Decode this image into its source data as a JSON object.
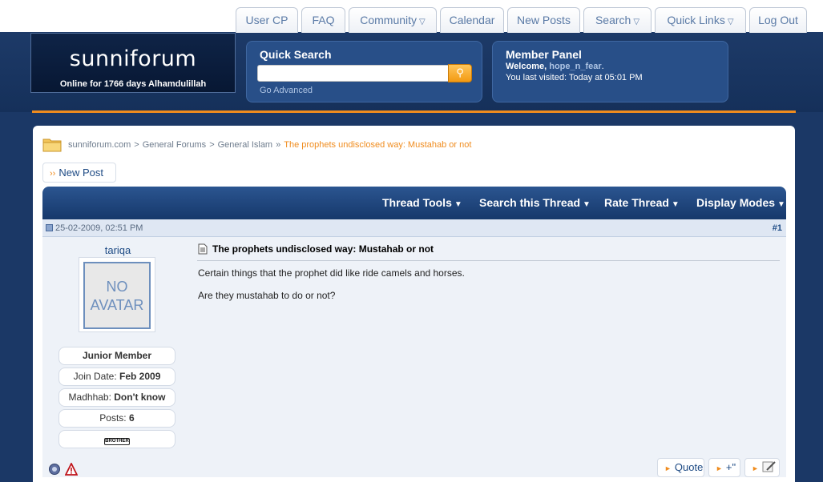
{
  "site": {
    "logo_text": "sunniforum",
    "logo_sub": "Online for 1766 days Alhamdulillah"
  },
  "nav": {
    "tabs": [
      {
        "label": "User CP",
        "has_menu": false
      },
      {
        "label": "FAQ",
        "has_menu": false
      },
      {
        "label": "Community",
        "has_menu": true
      },
      {
        "label": "Calendar",
        "has_menu": false
      },
      {
        "label": "New Posts",
        "has_menu": false
      },
      {
        "label": "Search",
        "has_menu": true
      },
      {
        "label": "Quick Links",
        "has_menu": true
      },
      {
        "label": "Log Out",
        "has_menu": false
      }
    ]
  },
  "quick_search": {
    "title": "Quick Search",
    "value": "",
    "placeholder": "",
    "go_advanced": "Go Advanced",
    "button_icon": "search-icon"
  },
  "member_panel": {
    "title": "Member Panel",
    "welcome_label": "Welcome,",
    "username": "hope_n_fear",
    "username_suffix": ".",
    "last_visit": "You last visited: Today at 05:01 PM"
  },
  "breadcrumb": {
    "items": [
      "sunniforum.com",
      "General Forums",
      "General Islam"
    ],
    "current": "The prophets undisclosed way: Mustahab or not"
  },
  "new_post_label": "New Post",
  "thread_tools": [
    "Thread Tools",
    "Search this Thread",
    "Rate Thread",
    "Display Modes"
  ],
  "post": {
    "date": "25-02-2009, 02:51 PM",
    "number": "#1",
    "author": {
      "name": "tariqa",
      "avatar_text": "NO AVATAR",
      "rank": "Junior Member",
      "join_label": "Join Date:",
      "join_value": "Feb 2009",
      "madhhab_label": "Madhhab:",
      "madhhab_value": "Don't know",
      "posts_label": "Posts:",
      "posts_value": "6",
      "badge": "BROTHER"
    },
    "title": "The prophets undisclosed way: Mustahab or not",
    "lines": [
      "Certain things that the prophet did like ride camels and horses.",
      "Are they mustahab to do or not?"
    ]
  },
  "post_actions": {
    "quote": "Quote",
    "multi_quote": "+\""
  },
  "colors": {
    "header_bg": "#1b3866",
    "accent_orange": "#f08c1e",
    "link_blue": "#1d4a84",
    "panel_bg": "#284f88"
  }
}
